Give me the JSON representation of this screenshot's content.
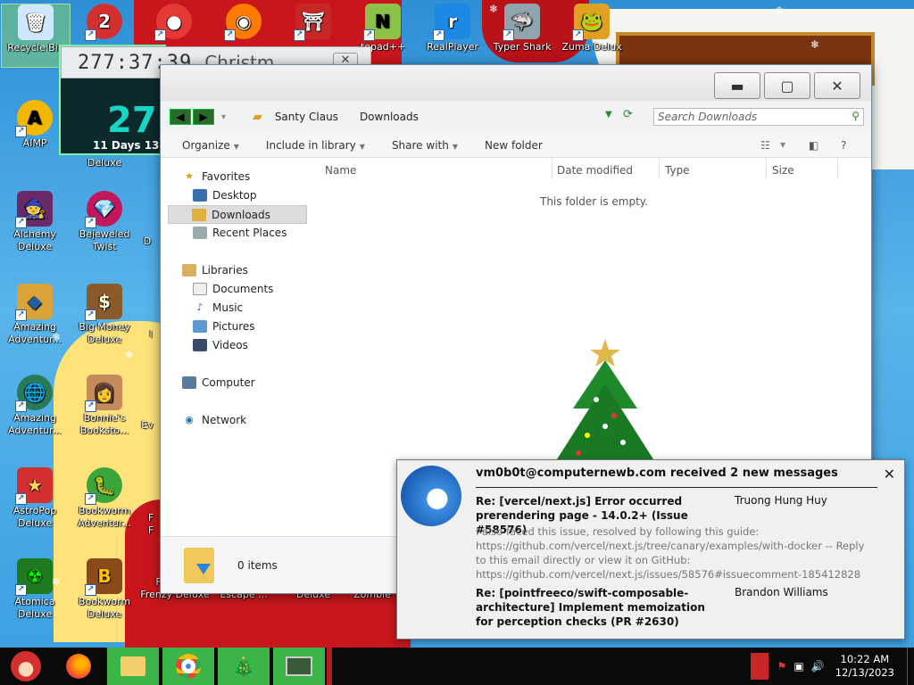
{
  "desktop": {
    "icons": [
      {
        "label": "Recycle Bin",
        "glyph": "🗑"
      },
      {
        "label": "AIMP",
        "glyph": "A"
      },
      {
        "label": "Deluxe",
        "glyph": ""
      },
      {
        "label": "Alchemy Deluxe",
        "glyph": "🧙"
      },
      {
        "label": "Bejeweled Twist",
        "glyph": "💎"
      },
      {
        "label": "Amazing Adventur...",
        "glyph": "◆"
      },
      {
        "label": "Big Money Deluxe",
        "glyph": "$"
      },
      {
        "label": "Amazing Adventur...",
        "glyph": "🌐"
      },
      {
        "label": "Bonnie's Booksto...",
        "glyph": "👩"
      },
      {
        "label": "AstroPop Deluxe",
        "glyph": "★"
      },
      {
        "label": "Bookworm Adventur...",
        "glyph": "🐛"
      },
      {
        "label": "Atomica Deluxe",
        "glyph": "☢"
      },
      {
        "label": "Bookworm Deluxe",
        "glyph": "B"
      },
      {
        "label": "Feeding Frenzy Deluxe",
        "glyph": "🐟"
      },
      {
        "label": "Mahjong Escape ...",
        "glyph": "🀄"
      },
      {
        "label": "Noah's Ark Deluxe",
        "glyph": "⛵"
      },
      {
        "label": "Plants v Zombie",
        "glyph": "🌱"
      },
      {
        "label": "tepad++",
        "glyph": "N"
      },
      {
        "label": "RealPlayer",
        "glyph": "r"
      },
      {
        "label": "Typer Shark",
        "glyph": "🦈"
      },
      {
        "label": "Zuma Delux",
        "glyph": "🐸"
      }
    ],
    "partial_labels": [
      "D",
      "l",
      "Ev",
      "F",
      "F"
    ]
  },
  "gadget": {
    "time": "277:37:39",
    "title": "Christm",
    "big_number": "27",
    "sub": "11 Days 13"
  },
  "explorer": {
    "breadcrumb": [
      "Santy Claus",
      "Downloads"
    ],
    "search_placeholder": "Search Downloads",
    "toolbar": [
      "Organize",
      "Include in library",
      "Share with",
      "New folder"
    ],
    "nav": {
      "favorites": "Favorites",
      "desktop": "Desktop",
      "downloads": "Downloads",
      "recent": "Recent Places",
      "libraries": "Libraries",
      "documents": "Documents",
      "music": "Music",
      "pictures": "Pictures",
      "videos": "Videos",
      "computer": "Computer",
      "network": "Network"
    },
    "columns": [
      "Name",
      "Date modified",
      "Type",
      "Size"
    ],
    "empty_text": "This folder is empty.",
    "status": "0 items"
  },
  "notification": {
    "header": "vm0b0t@computernewb.com received 2 new messages",
    "messages": [
      {
        "subject": "Re: [vercel/next.js] Error occurred prerendering page - 14.0.2+ (Issue #58576)",
        "from": "Truong Hung Huy",
        "body": "I also faced this issue, resolved by following this guide: https://github.com/vercel/next.js/tree/canary/examples/with-docker -- Reply to this email directly or view it on GitHub: https://github.com/vercel/next.js/issues/58576#issuecomment-185412828"
      },
      {
        "subject": "Re: [pointfreeco/swift-composable-architecture] Implement memoization for perception checks (PR #2630)",
        "from": "Brandon Williams",
        "body": ""
      }
    ]
  },
  "taskbar": {
    "time": "10:22 AM",
    "date": "12/13/2023"
  }
}
